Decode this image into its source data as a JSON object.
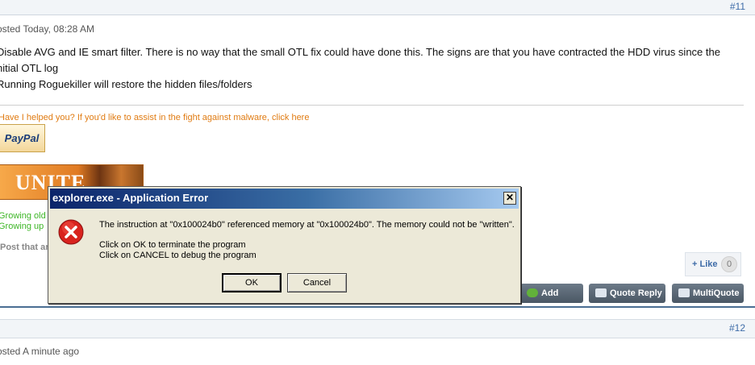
{
  "post11": {
    "number": "#11",
    "posted": "osted Today, 08:28 AM",
    "lines": [
      "Disable AVG and IE smart filter. There is no way that the small OTL fix could have done this. The signs are that you have contracted the HDD virus since the",
      "nitial OTL log",
      "Running Roguekiller will restore the hidden files/folders"
    ],
    "signature": "Have I helped you? If you'd like to assist in the fight against malware, click here",
    "paypal": "PayPal",
    "unite": "UNITE",
    "green1": "Growing old",
    "green2": "Growing up",
    "post_that": "Post that ar",
    "like_label": "+ Like",
    "like_count": "0",
    "actions": {
      "add_reply": "Add Reply",
      "quote_reply": "Quote Reply",
      "multiquote": "MultiQuote"
    }
  },
  "post12": {
    "number": "#12",
    "posted": "osted A minute ago"
  },
  "dialog": {
    "title": "explorer.exe - Application Error",
    "close_glyph": "✕",
    "message1": "The instruction at \"0x100024b0\" referenced memory at \"0x100024b0\". The memory could not be \"written\".",
    "message2": "Click on OK to terminate the program",
    "message3": "Click on CANCEL to debug the program",
    "ok": "OK",
    "cancel": "Cancel"
  },
  "colors": {
    "link": "#3e6ca8",
    "signature": "#e07b12",
    "green_text": "#3db626",
    "dialog_bg": "#ece9d8",
    "titlebar_start": "#0b246a",
    "error_red": "#d8231e"
  },
  "icons": {
    "error": "error-x-icon",
    "close": "close-icon",
    "add_reply": "reply-icon",
    "quote": "quote-icon",
    "multiquote": "multiquote-icon"
  }
}
